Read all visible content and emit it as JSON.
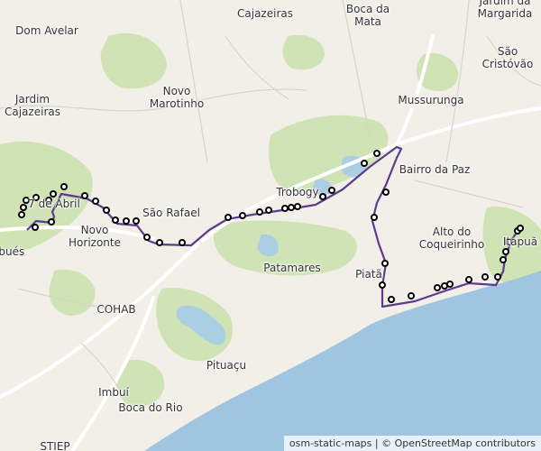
{
  "map": {
    "place_labels": [
      {
        "id": "cajazeiras",
        "text": "Cajazeiras"
      },
      {
        "id": "boca-da-mata",
        "text": "Boca da\nMata"
      },
      {
        "id": "jardim-margarida",
        "text": "Jardim da\nMargarida"
      },
      {
        "id": "dom-avelar",
        "text": "Dom Avelar"
      },
      {
        "id": "sao-cristovao",
        "text": "São\nCristóvão"
      },
      {
        "id": "jardim-cajazeiras",
        "text": "Jardim\nCajazeiras"
      },
      {
        "id": "novo-marotinho",
        "text": "Novo\nMarotinho"
      },
      {
        "id": "mussurunga",
        "text": "Mussurunga"
      },
      {
        "id": "bairro-da-paz",
        "text": "Bairro da Paz"
      },
      {
        "id": "trobogy",
        "text": "Trobogy"
      },
      {
        "id": "sete-de-abril",
        "text": "7 de Abril"
      },
      {
        "id": "sao-rafael",
        "text": "São Rafael"
      },
      {
        "id": "novo-horizonte",
        "text": "Novo\nHorizonte"
      },
      {
        "id": "alto-do-coqueirinho",
        "text": "Alto do\nCoqueirinho"
      },
      {
        "id": "itapua",
        "text": "Itapuã"
      },
      {
        "id": "piata",
        "text": "Piatã"
      },
      {
        "id": "patamares",
        "text": "Patamares"
      },
      {
        "id": "cohab",
        "text": "COHAB"
      },
      {
        "id": "pernambues",
        "text": "Pernambués"
      },
      {
        "id": "pituacu",
        "text": "Pituaçu"
      },
      {
        "id": "imbui",
        "text": "Imbuí"
      },
      {
        "id": "boca-do-rio",
        "text": "Boca do Rio"
      },
      {
        "id": "stiep",
        "text": "STIEP"
      }
    ],
    "route_color": "#5c3b8f",
    "stop_marker": "black-ring-white-fill",
    "attribution": "osm-static-maps | © OpenStreetMap contributors"
  }
}
